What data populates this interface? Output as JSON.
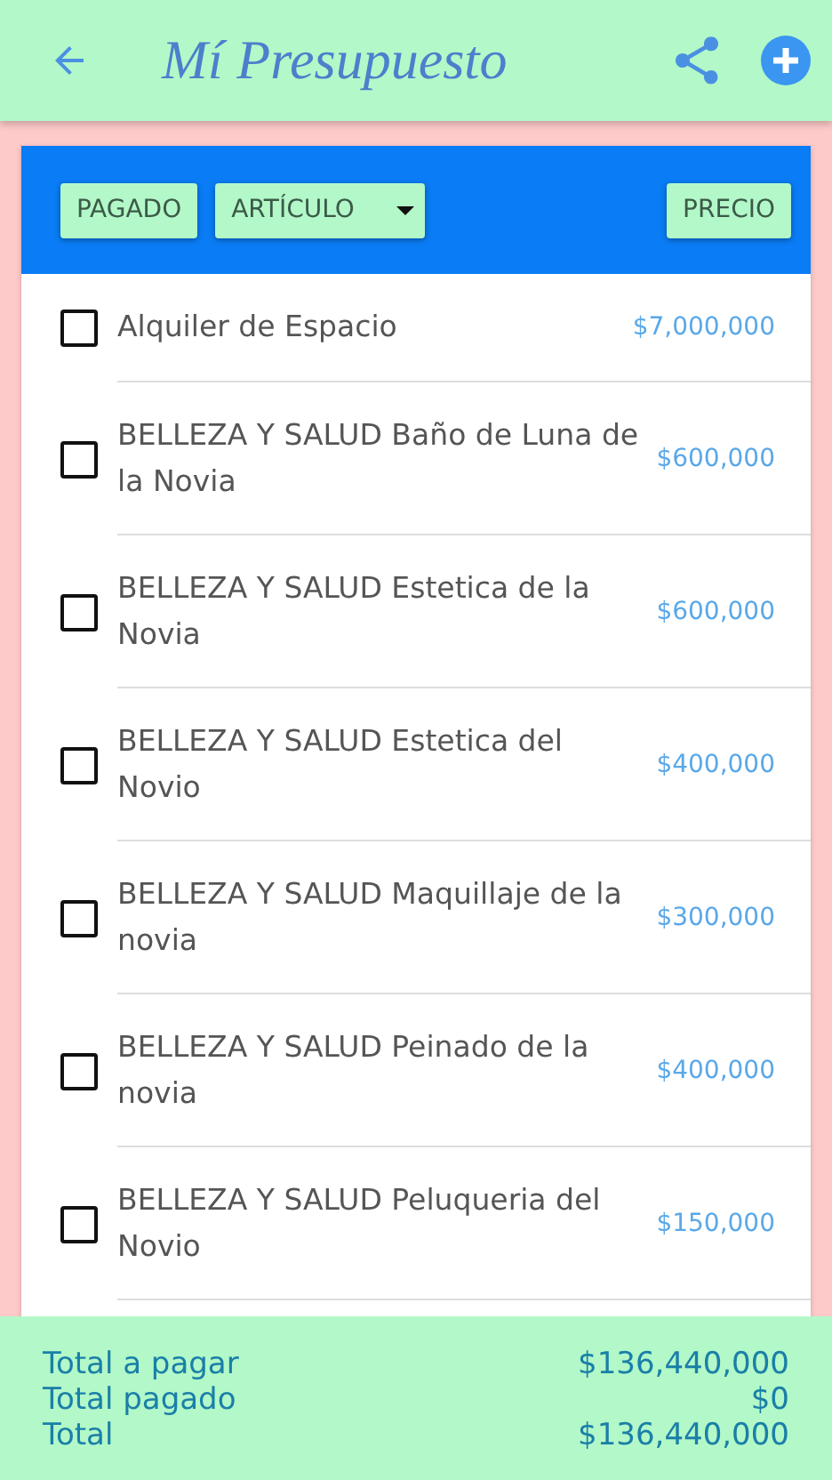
{
  "app_bar": {
    "title": "Mí Presupuesto"
  },
  "toolbar": {
    "buttons": [
      {
        "label": "PAGADO",
        "kind": "button"
      },
      {
        "label": "ARTÍCULO",
        "kind": "dropdown"
      },
      {
        "label": "PRECIO",
        "kind": "button"
      }
    ]
  },
  "items": [
    {
      "name": "Alquiler de Espacio",
      "price": "$7,000,000",
      "checked": false
    },
    {
      "name": "BELLEZA Y SALUD Baño de Luna de la Novia",
      "price": "$600,000",
      "checked": false
    },
    {
      "name": "BELLEZA Y SALUD Estetica de la Novia",
      "price": "$600,000",
      "checked": false
    },
    {
      "name": "BELLEZA Y SALUD Estetica del Novio",
      "price": "$400,000",
      "checked": false
    },
    {
      "name": "BELLEZA Y SALUD Maquillaje de la novia",
      "price": "$300,000",
      "checked": false
    },
    {
      "name": "BELLEZA Y SALUD Peinado de la novia",
      "price": "$400,000",
      "checked": false
    },
    {
      "name": "BELLEZA Y SALUD Peluqueria del Novio",
      "price": "$150,000",
      "checked": false
    }
  ],
  "totals": [
    {
      "label": "Total a pagar",
      "value": "$136,440,000"
    },
    {
      "label": "Total pagado",
      "value": "$0"
    },
    {
      "label": "Total",
      "value": "$136,440,000"
    }
  ]
}
